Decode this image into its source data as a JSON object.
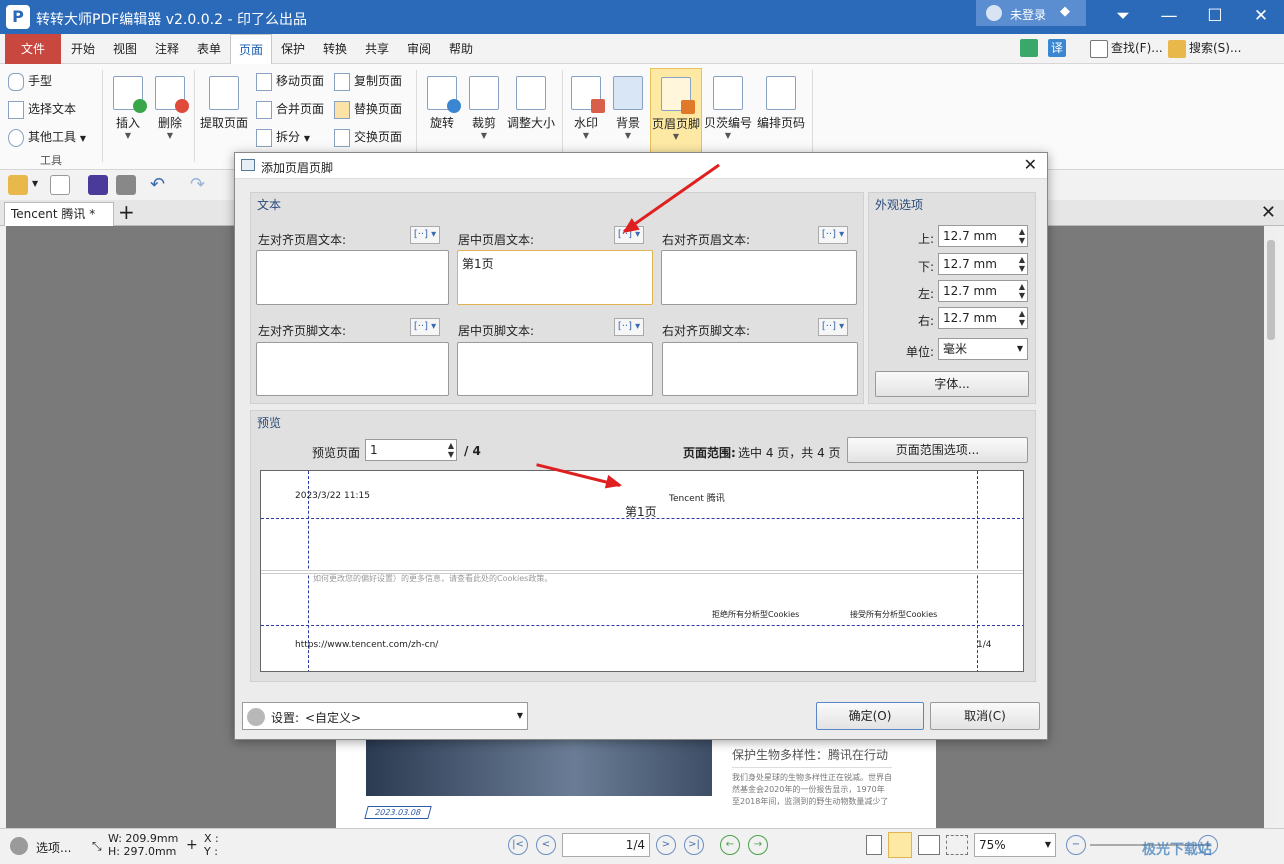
{
  "app": {
    "title": "转转大师PDF编辑器 v2.0.0.2 - 印了么出品",
    "login": "未登录",
    "logo": "P"
  },
  "menu": {
    "items": [
      "文件",
      "开始",
      "视图",
      "注释",
      "表单",
      "页面",
      "保护",
      "转换",
      "共享",
      "审阅",
      "帮助"
    ],
    "active": "页面",
    "find": "查找(F)...",
    "search": "搜索(S)..."
  },
  "ribbon": {
    "tools": {
      "hand": "手型",
      "select_text": "选择文本",
      "other_tools": "其他工具",
      "group_label": "工具"
    },
    "insert": "插入",
    "delete": "删除",
    "extract": "提取页面",
    "move": "移动页面",
    "merge": "合并页面",
    "split": "拆分",
    "copy": "复制页面",
    "replace": "替换页面",
    "swap": "交换页面",
    "rotate": "旋转",
    "crop": "裁剪",
    "resize": "调整大小",
    "watermark": "水印",
    "background": "背景",
    "header_footer": "页眉页脚",
    "bates": "贝茨编号",
    "page_number": "编排页码"
  },
  "tab": {
    "label": "Tencent 腾讯 *"
  },
  "dialog": {
    "title": "添加页眉页脚",
    "text_section": "文本",
    "appearance_section": "外观选项",
    "left_header_label": "左对齐页眉文本:",
    "center_header_label": "居中页眉文本:",
    "right_header_label": "右对齐页眉文本:",
    "left_footer_label": "左对齐页脚文本:",
    "center_footer_label": "居中页脚文本:",
    "right_footer_label": "右对齐页脚文本:",
    "center_header_value": "第1页",
    "margins": {
      "top_label": "上:",
      "top": "12.7 mm",
      "bottom_label": "下:",
      "bottom": "12.7 mm",
      "left_label": "左:",
      "left": "12.7 mm",
      "right_label": "右:",
      "right": "12.7 mm"
    },
    "unit_label": "单位:",
    "unit_value": "毫米",
    "font_button": "字体...",
    "preview_section": "预览",
    "preview_page_label": "预览页面",
    "preview_page_value": "1",
    "preview_total": "/ 4",
    "range_label": "页面范围:",
    "range_value": "选中 4 页，共 4 页",
    "range_button": "页面范围选项...",
    "settings_label": "设置:",
    "settings_value": "<自定义>",
    "ok": "确定(O)",
    "cancel": "取消(C)"
  },
  "preview": {
    "datetime": "2023/3/22 11:15",
    "center_title": "Tencent 腾讯",
    "header_text": "第1页",
    "cookie_text": "如何更改您的偏好设置）的更多信息，请查看此处的Cookies政策。",
    "reject_cookies": "拒绝所有分析型Cookies",
    "accept_cookies": "接受所有分析型Cookies",
    "url": "https://www.tencent.com/zh-cn/",
    "page_frac": "1/4"
  },
  "document": {
    "side_title": "保护生物多样性：腾讯在行动",
    "side_text": "我们身处星球的生物多样性正在锐减。世界自然基金会2020年的一份报告显示，1970年至2018年间，监测到的野生动物数量减少了",
    "date_tag": "2023.03.08"
  },
  "status": {
    "options": "选项...",
    "width": "W: 209.9mm",
    "height": "H: 297.0mm",
    "x": "X :",
    "y": "Y :",
    "page_input": "1/4",
    "zoom": "75%",
    "watermark": "极光下载站"
  },
  "colors": {
    "titlebar": "#2a6ab8",
    "file_menu": "#c8473f",
    "arrow": "#e02020",
    "guide": "#2a3aa0"
  }
}
